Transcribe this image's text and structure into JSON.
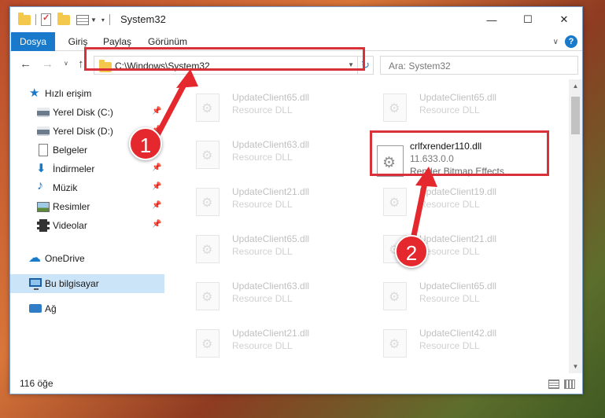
{
  "window": {
    "title": "System32",
    "minimize": "—",
    "maximize": "☐",
    "close": "✕"
  },
  "ribbon": {
    "tabs": [
      "Dosya",
      "Giriş",
      "Paylaş",
      "Görünüm"
    ],
    "help": "?",
    "collapse": "∨"
  },
  "navigation": {
    "back": "←",
    "forward": "→",
    "recent": "∨",
    "up": "↑",
    "address_path": "C:\\Windows\\System32",
    "refresh": "↻",
    "search_placeholder": "Ara: System32"
  },
  "sidebar": {
    "items": [
      {
        "label": "Hızlı erişim",
        "icon": "star-icon",
        "pinned": false
      },
      {
        "label": "Yerel Disk (C:)",
        "icon": "disk-icon",
        "pinned": true
      },
      {
        "label": "Yerel Disk (D:)",
        "icon": "disk-icon",
        "pinned": true
      },
      {
        "label": "Belgeler",
        "icon": "document-icon",
        "pinned": true
      },
      {
        "label": "İndirmeler",
        "icon": "download-icon",
        "pinned": true
      },
      {
        "label": "Müzik",
        "icon": "music-icon",
        "pinned": true
      },
      {
        "label": "Resimler",
        "icon": "pictures-icon",
        "pinned": true
      },
      {
        "label": "Videolar",
        "icon": "video-icon",
        "pinned": true
      },
      {
        "label": "OneDrive",
        "icon": "cloud-icon",
        "pinned": false
      },
      {
        "label": "Bu bilgisayar",
        "icon": "computer-icon",
        "pinned": false,
        "selected": true
      },
      {
        "label": "Ağ",
        "icon": "network-icon",
        "pinned": false
      }
    ]
  },
  "files": {
    "left_column": [
      {
        "name": "UpdateClient65.dll",
        "desc": "Resource DLL"
      },
      {
        "name": "UpdateClient63.dll",
        "desc": "Resource DLL"
      },
      {
        "name": "UpdateClient21.dll",
        "desc": "Resource DLL"
      },
      {
        "name": "UpdateClient65.dll",
        "desc": "Resource DLL"
      },
      {
        "name": "UpdateClient63.dll",
        "desc": "Resource DLL"
      },
      {
        "name": "UpdateClient21.dll",
        "desc": "Resource DLL"
      }
    ],
    "right_column": [
      {
        "name": "UpdateClient65.dll",
        "desc": "Resource DLL"
      },
      {
        "name": "UpdateClient19.dll",
        "desc": "Resource DLL"
      },
      {
        "name": "UpdateClient21.dll",
        "desc": "Resource DLL"
      },
      {
        "name": "UpdateClient65.dll",
        "desc": "Resource DLL"
      },
      {
        "name": "UpdateClient42.dll",
        "desc": "Resource DLL"
      }
    ],
    "highlighted": {
      "name": "crlfxrender110.dll",
      "version": "11.633.0.0",
      "desc": "Render Bitmap Effects"
    }
  },
  "status": {
    "item_count": "116 öğe"
  },
  "annotations": {
    "step1": "1",
    "step2": "2",
    "color": "#e4282e"
  }
}
